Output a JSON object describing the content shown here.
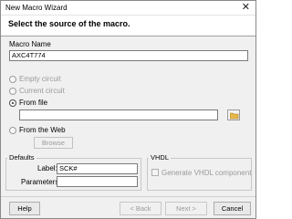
{
  "window": {
    "title": "New Macro Wizard",
    "close_glyph": "✕"
  },
  "header": {
    "heading": "Select the source of the macro."
  },
  "macro_name": {
    "label": "Macro Name",
    "value": "AXC4T774"
  },
  "source": {
    "options": [
      {
        "label": "Empty circuit",
        "selected": false,
        "enabled": false
      },
      {
        "label": "Current circuit",
        "selected": false,
        "enabled": false
      },
      {
        "label": "From file",
        "selected": true,
        "enabled": true
      },
      {
        "label": "From the Web",
        "selected": false,
        "enabled": true
      }
    ],
    "file_path": "",
    "browse_label": "Browse"
  },
  "defaults": {
    "group_label": "Defaults",
    "label_caption": "Label:",
    "label_value": "SCK#",
    "parameters_caption": "Parameters:",
    "parameters_value": ""
  },
  "vhdl": {
    "group_label": "VHDL",
    "generate_label": "Generate VHDL component",
    "generate_checked": false
  },
  "buttons": {
    "help": "Help",
    "back": "< Back",
    "next": "Next >",
    "cancel": "Cancel"
  },
  "colors": {
    "window_bg": "#f0f0f0",
    "header_bg": "#ffffff",
    "disabled_text": "#9a9a9a",
    "folder_icon": "#e8b84a"
  }
}
